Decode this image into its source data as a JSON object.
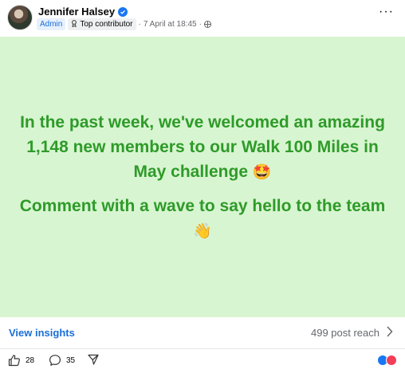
{
  "author": {
    "name": "Jennifer Halsey",
    "role_badge": "Admin",
    "contributor_badge": "Top contributor",
    "separator": "·",
    "time": "7 April at 18:45",
    "time_separator": "·"
  },
  "post": {
    "line1": "In the past week, we've welcomed an amazing 1,148 new members to our Walk 100 Miles in May challenge",
    "line1_emoji": "🤩",
    "line2": "Comment with a wave to say hello to the team",
    "line2_emoji": "👋",
    "background_color": "#d8f5d1",
    "text_color": "#2e9b29"
  },
  "insights": {
    "link_label": "View insights",
    "reach_label": "499 post reach"
  },
  "actions": {
    "like_count": "28",
    "comment_count": "35"
  },
  "icons": {
    "more": "more-icon",
    "verified": "verified-icon",
    "globe": "globe-icon",
    "like": "thumbs-up-icon",
    "comment": "comment-icon",
    "share": "send-icon",
    "reactions": [
      "like-reaction-icon",
      "love-reaction-icon"
    ]
  }
}
